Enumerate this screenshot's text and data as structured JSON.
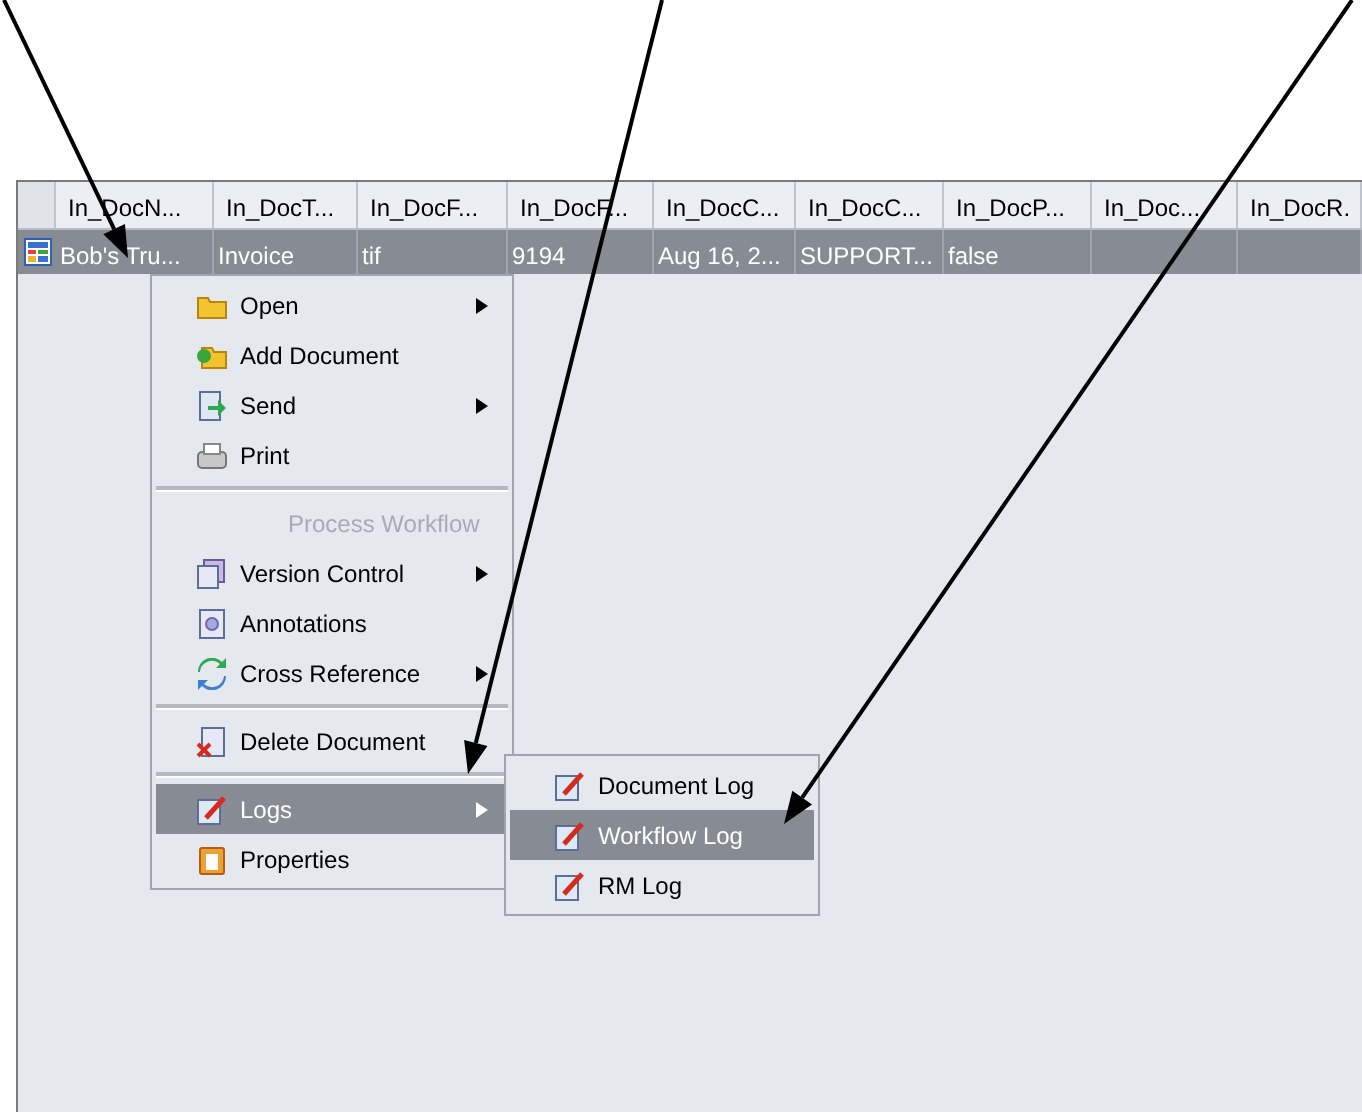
{
  "table": {
    "columns": [
      "In_DocN...",
      "In_DocT...",
      "In_DocF...",
      "In_DocF...",
      "In_DocC...",
      "In_DocC...",
      "In_DocP...",
      "In_Doc...",
      "In_DocR."
    ],
    "rows": [
      {
        "selected": true,
        "cells": [
          "Bob's Tru...",
          "Invoice",
          "tif",
          "9194",
          "Aug 16, 2...",
          "SUPPORT...",
          "false",
          "",
          ""
        ]
      }
    ]
  },
  "context_menu": {
    "items": [
      {
        "kind": "item",
        "label": "Open",
        "submenu": true,
        "disabled": false,
        "selected": false
      },
      {
        "kind": "item",
        "label": "Add Document",
        "submenu": false,
        "disabled": false,
        "selected": false
      },
      {
        "kind": "item",
        "label": "Send",
        "submenu": true,
        "disabled": false,
        "selected": false
      },
      {
        "kind": "item",
        "label": "Print",
        "submenu": false,
        "disabled": false,
        "selected": false
      },
      {
        "kind": "separator"
      },
      {
        "kind": "item",
        "label": "Process Workflow",
        "submenu": false,
        "disabled": true,
        "selected": false
      },
      {
        "kind": "item",
        "label": "Version Control",
        "submenu": true,
        "disabled": false,
        "selected": false
      },
      {
        "kind": "item",
        "label": "Annotations",
        "submenu": false,
        "disabled": false,
        "selected": false
      },
      {
        "kind": "item",
        "label": "Cross Reference",
        "submenu": true,
        "disabled": false,
        "selected": false
      },
      {
        "kind": "separator"
      },
      {
        "kind": "item",
        "label": "Delete Document",
        "submenu": false,
        "disabled": false,
        "selected": false
      },
      {
        "kind": "separator"
      },
      {
        "kind": "item",
        "label": "Logs",
        "submenu": true,
        "disabled": false,
        "selected": true
      },
      {
        "kind": "item",
        "label": "Properties",
        "submenu": false,
        "disabled": false,
        "selected": false
      }
    ]
  },
  "submenu": {
    "items": [
      {
        "label": "Document Log",
        "selected": false
      },
      {
        "label": "Workflow Log",
        "selected": true
      },
      {
        "label": "RM Log",
        "selected": false
      }
    ]
  }
}
